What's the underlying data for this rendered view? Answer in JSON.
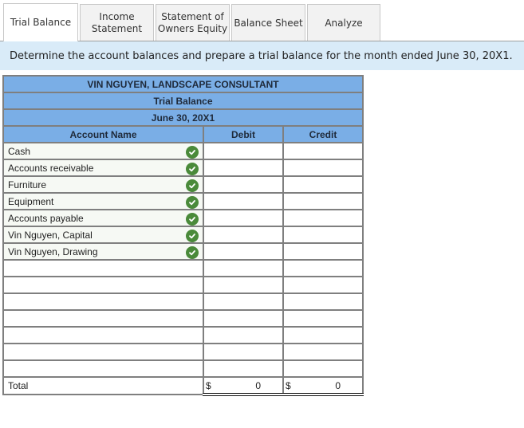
{
  "tabs": [
    {
      "label": "Trial Balance",
      "active": true
    },
    {
      "label": "Income Statement",
      "line1": "Income",
      "line2": "Statement",
      "active": false
    },
    {
      "label": "Statement of Owners Equity",
      "line1": "Statement of",
      "line2": "Owners Equity",
      "active": false
    },
    {
      "label": "Balance Sheet",
      "active": false
    },
    {
      "label": "Analyze",
      "active": false
    }
  ],
  "instruction": "Determine the account balances and prepare a trial balance for the month ended June 30, 20X1.",
  "trial_balance": {
    "company": "VIN NGUYEN,  LANDSCAPE CONSULTANT",
    "title": "Trial Balance",
    "date": "June 30, 20X1",
    "columns": {
      "name": "Account Name",
      "debit": "Debit",
      "credit": "Credit"
    },
    "rows": [
      {
        "account": "Cash",
        "status": "correct",
        "debit": "",
        "credit": ""
      },
      {
        "account": "Accounts receivable",
        "status": "correct",
        "debit": "",
        "credit": ""
      },
      {
        "account": "Furniture",
        "status": "correct",
        "debit": "",
        "credit": ""
      },
      {
        "account": "Equipment",
        "status": "correct",
        "debit": "",
        "credit": ""
      },
      {
        "account": "Accounts payable",
        "status": "correct",
        "debit": "",
        "credit": ""
      },
      {
        "account": "Vin Nguyen, Capital",
        "status": "correct",
        "debit": "",
        "credit": ""
      },
      {
        "account": "Vin Nguyen, Drawing",
        "status": "correct",
        "debit": "",
        "credit": ""
      },
      {
        "account": "",
        "debit": "",
        "credit": ""
      },
      {
        "account": "",
        "debit": "",
        "credit": ""
      },
      {
        "account": "",
        "debit": "",
        "credit": ""
      },
      {
        "account": "",
        "debit": "",
        "credit": ""
      },
      {
        "account": "",
        "debit": "",
        "credit": ""
      },
      {
        "account": "",
        "debit": "",
        "credit": ""
      },
      {
        "account": "",
        "debit": "",
        "credit": ""
      }
    ],
    "total": {
      "label": "Total",
      "currency": "$",
      "debit": "0",
      "credit": "0"
    }
  },
  "colors": {
    "header_blue": "#7aaee6",
    "instruction_bg": "#d9ebf8",
    "check_green": "#4a8a3a"
  }
}
